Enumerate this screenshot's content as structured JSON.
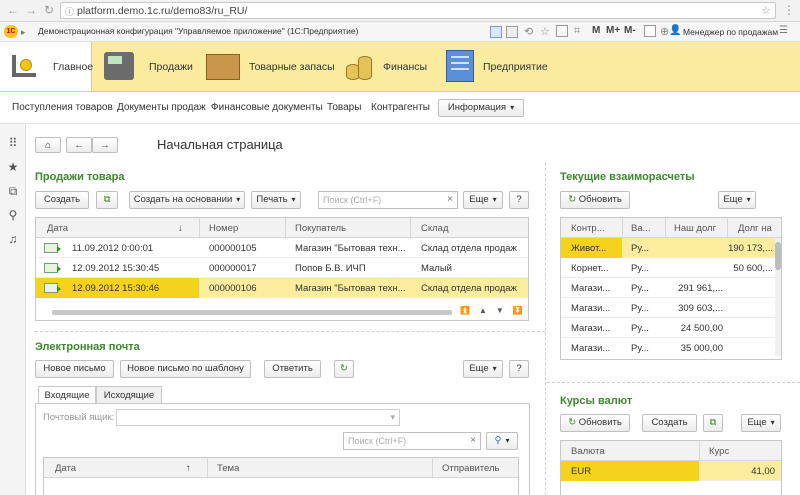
{
  "browser": {
    "url": "platform.demo.1c.ru/demo83/ru_RU/"
  },
  "app": {
    "title": "Демонстрационная конфигурация \"Управляемое приложение\"   (1С:Предприятие)",
    "mark": "M",
    "mark_plus": "M+",
    "mark_minus": "M-",
    "user": "Менеджер по продажам"
  },
  "sections": [
    {
      "label": "Главное"
    },
    {
      "label": "Продажи"
    },
    {
      "label": "Товарные запасы"
    },
    {
      "label": "Финансы"
    },
    {
      "label": "Предприятие"
    }
  ],
  "commands": [
    "Поступления товаров",
    "Документы продаж",
    "Финансовые документы",
    "Товары",
    "Контрагенты"
  ],
  "info_button": "Информация",
  "page_title": "Начальная страница",
  "sales": {
    "title": "Продажи товара",
    "create": "Создать",
    "create_based": "Создать на основании",
    "print": "Печать",
    "search_placeholder": "Поиск (Ctrl+F)",
    "more": "Еще",
    "help": "?",
    "columns": [
      "Дата",
      "Номер",
      "Покупатель",
      "Склад"
    ],
    "sort_indicator": "↓",
    "rows": [
      {
        "date": "11.09.2012 0:00:01",
        "number": "000000105",
        "buyer": "Магазин \"Бытовая техн...",
        "store": "Склад отдела продаж"
      },
      {
        "date": "12.09.2012 15:30:45",
        "number": "000000017",
        "buyer": "Попов Б.В. ИЧП",
        "store": "Малый"
      },
      {
        "date": "12.09.2012 15:30:46",
        "number": "000000106",
        "buyer": "Магазин \"Бытовая техн...",
        "store": "Склад отдела продаж"
      }
    ]
  },
  "email": {
    "title": "Электронная почта",
    "new_letter": "Новое письмо",
    "new_by_template": "Новое письмо по шаблону",
    "reply": "Ответить",
    "more": "Еще",
    "help": "?",
    "tabs": [
      "Входящие",
      "Исходящие"
    ],
    "mailbox_label": "Почтовый ящик:",
    "search_placeholder": "Поиск (Ctrl+F)",
    "columns": [
      "Дата",
      "Тема",
      "Отправитель"
    ],
    "sort_indicator": "↑"
  },
  "settlements": {
    "title": "Текущие взаиморасчеты",
    "refresh": "Обновить",
    "more": "Еще",
    "columns": [
      "Контр...",
      "Ва...",
      "Наш долг",
      "Долг на"
    ],
    "rows": [
      {
        "a": "Живот...",
        "b": "Ру...",
        "c": "",
        "d": "190 173,..."
      },
      {
        "a": "Корнет...",
        "b": "Ру...",
        "c": "",
        "d": "50 600,..."
      },
      {
        "a": "Магази...",
        "b": "Ру...",
        "c": "291 961,...",
        "d": ""
      },
      {
        "a": "Магази...",
        "b": "Ру...",
        "c": "309 603,...",
        "d": ""
      },
      {
        "a": "Магази...",
        "b": "Ру...",
        "c": "24 500,00",
        "d": ""
      },
      {
        "a": "Магази...",
        "b": "Ру...",
        "c": "35 000,00",
        "d": ""
      }
    ]
  },
  "rates": {
    "title": "Курсы валют",
    "refresh": "Обновить",
    "create": "Создать",
    "more": "Еще",
    "columns": [
      "Валюта",
      "Курс"
    ],
    "rows": [
      {
        "currency": "EUR",
        "rate": "41,00"
      }
    ]
  },
  "colors": {
    "accent_green": "#3b8a2a",
    "section_bar": "#fbeb9f",
    "selection": "#fbec9e",
    "selection_strong": "#f5d21c"
  }
}
